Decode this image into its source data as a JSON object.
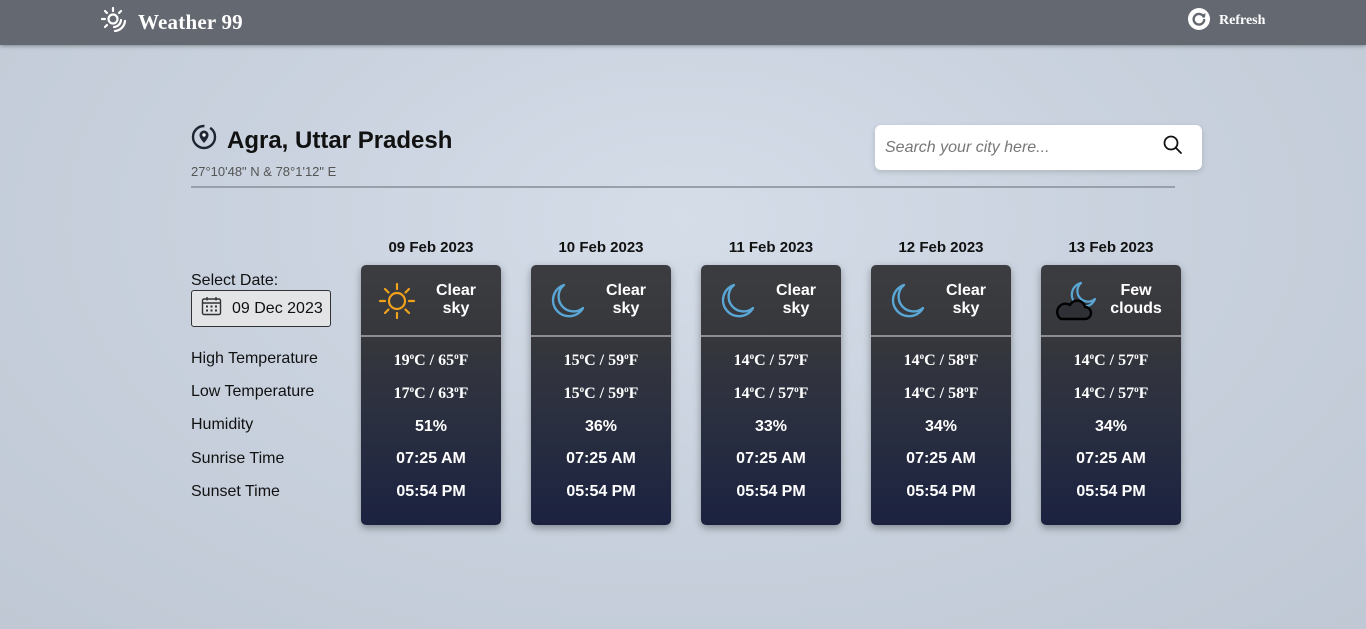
{
  "header": {
    "brand": "Weather 99",
    "refresh_label": "Refresh",
    "logo_icon": "sun-weather-logo-icon",
    "refresh_icon": "refresh-icon"
  },
  "location": {
    "name": "Agra, Uttar Pradesh",
    "coords": "27°10'48\" N & 78°1'12\" E",
    "icon": "location-pin-icon"
  },
  "search": {
    "placeholder": "Search your city here...",
    "value": "",
    "icon": "search-icon"
  },
  "date_select": {
    "label": "Select Date:",
    "value": "09 Dec 2023",
    "icon": "calendar-icon"
  },
  "row_labels": [
    "High Temperature",
    "Low Temperature",
    "Humidity",
    "Sunrise Time",
    "Sunset Time"
  ],
  "forecast": [
    {
      "date": "09 Feb 2023",
      "desc": "Clear\nsky",
      "icon": "sun-icon",
      "high_c": "19",
      "high_f": "65",
      "low_c": "17",
      "low_f": "63",
      "humidity": "51%",
      "sunrise": "07:25 AM",
      "sunset": "05:54 PM"
    },
    {
      "date": "10 Feb 2023",
      "desc": "Clear\nsky",
      "icon": "moon-icon",
      "high_c": "15",
      "high_f": "59",
      "low_c": "15",
      "low_f": "59",
      "humidity": "36%",
      "sunrise": "07:25 AM",
      "sunset": "05:54 PM"
    },
    {
      "date": "11 Feb 2023",
      "desc": "Clear\nsky",
      "icon": "moon-icon",
      "high_c": "14",
      "high_f": "57",
      "low_c": "14",
      "low_f": "57",
      "humidity": "33%",
      "sunrise": "07:25 AM",
      "sunset": "05:54 PM"
    },
    {
      "date": "12 Feb 2023",
      "desc": "Clear\nsky",
      "icon": "moon-icon",
      "high_c": "14",
      "high_f": "58",
      "low_c": "14",
      "low_f": "58",
      "humidity": "34%",
      "sunrise": "07:25 AM",
      "sunset": "05:54 PM"
    },
    {
      "date": "13 Feb 2023",
      "desc": "Few\nclouds",
      "icon": "moon-cloud-icon",
      "high_c": "14",
      "high_f": "57",
      "low_c": "14",
      "low_f": "57",
      "humidity": "34%",
      "sunrise": "07:25 AM",
      "sunset": "05:54 PM"
    }
  ],
  "units": {
    "celsius": "C",
    "fahrenheit": "F",
    "degree": "o",
    "separator": " / "
  },
  "colors": {
    "topbar": "#646870",
    "sun": "#f0a21a",
    "moon": "#5aa7d6"
  }
}
